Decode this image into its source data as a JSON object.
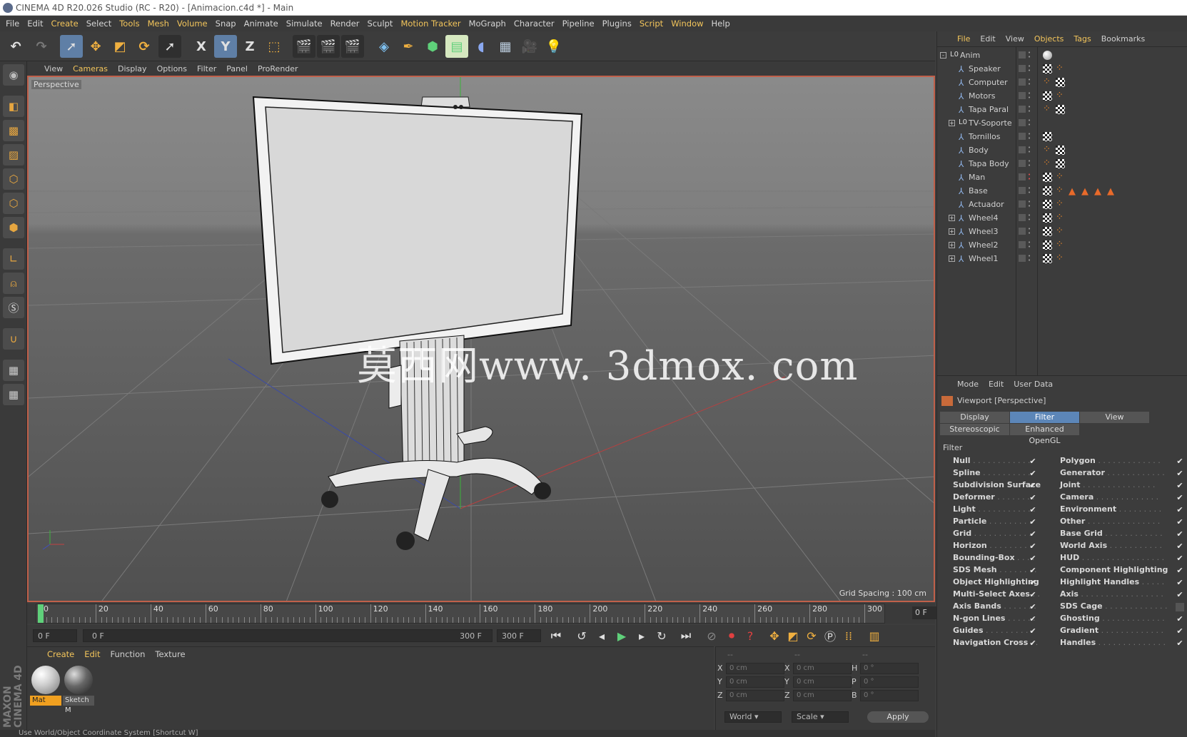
{
  "window": {
    "title": "CINEMA 4D R20.026 Studio (RC - R20) - [Animacion.c4d *] - Main"
  },
  "menu": [
    {
      "label": "File",
      "hl": false
    },
    {
      "label": "Edit",
      "hl": false
    },
    {
      "label": "Create",
      "hl": true
    },
    {
      "label": "Select",
      "hl": false
    },
    {
      "label": "Tools",
      "hl": true
    },
    {
      "label": "Mesh",
      "hl": true
    },
    {
      "label": "Volume",
      "hl": true
    },
    {
      "label": "Snap",
      "hl": false
    },
    {
      "label": "Animate",
      "hl": false
    },
    {
      "label": "Simulate",
      "hl": false
    },
    {
      "label": "Render",
      "hl": false
    },
    {
      "label": "Sculpt",
      "hl": false
    },
    {
      "label": "Motion Tracker",
      "hl": true
    },
    {
      "label": "MoGraph",
      "hl": false
    },
    {
      "label": "Character",
      "hl": false
    },
    {
      "label": "Pipeline",
      "hl": false
    },
    {
      "label": "Plugins",
      "hl": false
    },
    {
      "label": "Script",
      "hl": true
    },
    {
      "label": "Window",
      "hl": true
    },
    {
      "label": "Help",
      "hl": false
    }
  ],
  "toolbar": {
    "undo_icon": "undo-icon",
    "redo_icon": "redo-icon",
    "x_label": "X",
    "y_label": "Y",
    "z_label": "Z"
  },
  "viewport": {
    "menu": [
      {
        "label": "View",
        "hl": false
      },
      {
        "label": "Cameras",
        "hl": true
      },
      {
        "label": "Display",
        "hl": false
      },
      {
        "label": "Options",
        "hl": false
      },
      {
        "label": "Filter",
        "hl": false
      },
      {
        "label": "Panel",
        "hl": false
      },
      {
        "label": "ProRender",
        "hl": false
      }
    ],
    "camera_label": "Perspective",
    "grid_spacing": "Grid Spacing : 100 cm",
    "watermark": "莫西网www. 3dmox. com"
  },
  "timeline": {
    "ticks": [
      "0",
      "20",
      "40",
      "60",
      "80",
      "100",
      "120",
      "140",
      "160",
      "180",
      "200",
      "220",
      "240",
      "260",
      "280",
      "300"
    ],
    "current_frame": "0 F"
  },
  "transport": {
    "start_field": "0 F",
    "range_start": "0 F",
    "range_end": "300 F",
    "end_field": "300 F"
  },
  "material_manager": {
    "menu": [
      {
        "label": "Create",
        "hl": true
      },
      {
        "label": "Edit",
        "hl": true
      },
      {
        "label": "Function",
        "hl": false
      },
      {
        "label": "Texture",
        "hl": false
      }
    ],
    "materials": [
      {
        "name": "Mat",
        "selected": true
      },
      {
        "name": "Sketch M",
        "selected": false
      }
    ]
  },
  "coordinates": {
    "header": [
      "--",
      "--",
      "--"
    ],
    "rows": [
      {
        "a": "X",
        "av": "0 cm",
        "b": "X",
        "bv": "0 cm",
        "c": "H",
        "cv": "0 °"
      },
      {
        "a": "Y",
        "av": "0 cm",
        "b": "Y",
        "bv": "0 cm",
        "c": "P",
        "cv": "0 °"
      },
      {
        "a": "Z",
        "av": "0 cm",
        "b": "Z",
        "bv": "0 cm",
        "c": "B",
        "cv": "0 °"
      }
    ],
    "mode": "World",
    "transform": "Scale",
    "apply": "Apply"
  },
  "status": "Use World/Object Coordinate System [Shortcut W]",
  "brand": "MAXON CINEMA 4D",
  "object_manager": {
    "menu": [
      {
        "label": "File",
        "hl": true
      },
      {
        "label": "Edit",
        "hl": false
      },
      {
        "label": "View",
        "hl": false
      },
      {
        "label": "Objects",
        "hl": true
      },
      {
        "label": "Tags",
        "hl": true
      },
      {
        "label": "Bookmarks",
        "hl": false
      }
    ],
    "objects": [
      {
        "name": "Anim",
        "type": "null",
        "expand": "-",
        "indent": 0,
        "tags": [
          "sphere"
        ]
      },
      {
        "name": "Speaker",
        "type": "joint",
        "expand": "",
        "indent": 1,
        "tags": [
          "check",
          "dots"
        ]
      },
      {
        "name": "Computer",
        "type": "joint",
        "expand": "",
        "indent": 1,
        "tags": [
          "dots",
          "check"
        ]
      },
      {
        "name": "Motors",
        "type": "joint",
        "expand": "",
        "indent": 1,
        "tags": [
          "check",
          "dots"
        ]
      },
      {
        "name": "Tapa Paral",
        "type": "joint",
        "expand": "",
        "indent": 1,
        "tags": [
          "dots",
          "check"
        ]
      },
      {
        "name": "TV-Soporte",
        "type": "null",
        "expand": "+",
        "indent": 1,
        "tags": []
      },
      {
        "name": "Tornillos",
        "type": "joint",
        "expand": "",
        "indent": 1,
        "tags": [
          "check"
        ]
      },
      {
        "name": "Body",
        "type": "joint",
        "expand": "",
        "indent": 1,
        "tags": [
          "dots",
          "check"
        ]
      },
      {
        "name": "Tapa Body",
        "type": "joint",
        "expand": "",
        "indent": 1,
        "tags": [
          "dots",
          "check"
        ]
      },
      {
        "name": "Man",
        "type": "joint",
        "expand": "",
        "indent": 1,
        "tags": [
          "check",
          "dots"
        ]
      },
      {
        "name": "Base",
        "type": "joint",
        "expand": "",
        "indent": 1,
        "tags": [
          "check",
          "dots",
          "tri",
          "tri",
          "tri",
          "tri"
        ]
      },
      {
        "name": "Actuador",
        "type": "joint",
        "expand": "",
        "indent": 1,
        "tags": [
          "check",
          "dots"
        ]
      },
      {
        "name": "Wheel4",
        "type": "joint",
        "expand": "+",
        "indent": 1,
        "tags": [
          "check",
          "dots"
        ]
      },
      {
        "name": "Wheel3",
        "type": "joint",
        "expand": "+",
        "indent": 1,
        "tags": [
          "check",
          "dots"
        ]
      },
      {
        "name": "Wheel2",
        "type": "joint",
        "expand": "+",
        "indent": 1,
        "tags": [
          "check",
          "dots"
        ]
      },
      {
        "name": "Wheel1",
        "type": "joint",
        "expand": "+",
        "indent": 1,
        "tags": [
          "check",
          "dots"
        ]
      }
    ]
  },
  "attribute_manager": {
    "menu": [
      "Mode",
      "Edit",
      "User Data"
    ],
    "title": "Viewport [Perspective]",
    "tabs": [
      {
        "label": "Display",
        "on": false
      },
      {
        "label": "Filter",
        "on": true
      },
      {
        "label": "View",
        "on": false
      }
    ],
    "tabs2": [
      {
        "label": "Stereoscopic",
        "on": false
      },
      {
        "label": "Enhanced OpenGL",
        "on": false
      }
    ],
    "filter_title": "Filter",
    "filters_left": [
      {
        "label": "Null",
        "dots": ". . . . . . . . . . . .",
        "checked": true
      },
      {
        "label": "Spline",
        "dots": ". . . . . . . . . .",
        "checked": true
      },
      {
        "label": "Subdivision Surface",
        "dots": "",
        "checked": true
      },
      {
        "label": "Deformer",
        "dots": ". . . . . . . .",
        "checked": true
      },
      {
        "label": "Light",
        "dots": ". . . . . . . . . . . .",
        "checked": true
      },
      {
        "label": "Particle",
        "dots": ". . . . . . . . .",
        "checked": true
      },
      {
        "label": "Grid",
        "dots": ". . . . . . . . . . . .",
        "checked": true
      },
      {
        "label": "Horizon",
        "dots": ". . . . . . . . .",
        "checked": true
      },
      {
        "label": "Bounding-Box",
        "dots": ". . . .",
        "checked": true
      },
      {
        "label": "SDS Mesh",
        "dots": ". . . . . . . .",
        "checked": true
      },
      {
        "label": "Object Highlighting",
        "dots": "",
        "checked": true
      },
      {
        "label": "Multi-Select Axes",
        "dots": ". .",
        "checked": true
      },
      {
        "label": "Axis Bands",
        "dots": ". . . . . . .",
        "checked": true
      },
      {
        "label": "N-gon Lines",
        "dots": ". . . . . .",
        "checked": true
      },
      {
        "label": "Guides",
        "dots": ". . . . . . . . . .",
        "checked": true
      },
      {
        "label": "Navigation Cross",
        "dots": ". .",
        "checked": true
      }
    ],
    "filters_right": [
      {
        "label": "Polygon",
        "dots": ". . . . . . . . . . . . .",
        "checked": true
      },
      {
        "label": "Generator",
        "dots": ". . . . . . . . . . . .",
        "checked": true
      },
      {
        "label": "Joint",
        "dots": ". . . . . . . . . . . . . . .",
        "checked": true
      },
      {
        "label": "Camera",
        "dots": ". . . . . . . . . . . . .",
        "checked": true
      },
      {
        "label": "Environment",
        "dots": ". . . . . . . . .",
        "checked": true
      },
      {
        "label": "Other",
        "dots": ". . . . . . . . . . . . . . .",
        "checked": true
      },
      {
        "label": "Base Grid",
        "dots": ". . . . . . . . . . . .",
        "checked": true
      },
      {
        "label": "World Axis",
        "dots": ". . . . . . . . . . .",
        "checked": true
      },
      {
        "label": "HUD",
        "dots": ". . . . . . . . . . . . . . . . .",
        "checked": true
      },
      {
        "label": "Component Highlighting",
        "dots": "",
        "checked": true
      },
      {
        "label": "Highlight Handles",
        "dots": ". . . . .",
        "checked": true
      },
      {
        "label": "Axis",
        "dots": ". . . . . . . . . . . . . . . . .",
        "checked": true
      },
      {
        "label": "SDS Cage",
        "dots": ". . . . . . . . . . . . .",
        "checked": false
      },
      {
        "label": "Ghosting",
        "dots": ". . . . . . . . . . . . .",
        "checked": true
      },
      {
        "label": "Gradient",
        "dots": ". . . . . . . . . . . . .",
        "checked": true
      },
      {
        "label": "Handles",
        "dots": ". . . . . . . . . . . . . .",
        "checked": true
      }
    ]
  }
}
